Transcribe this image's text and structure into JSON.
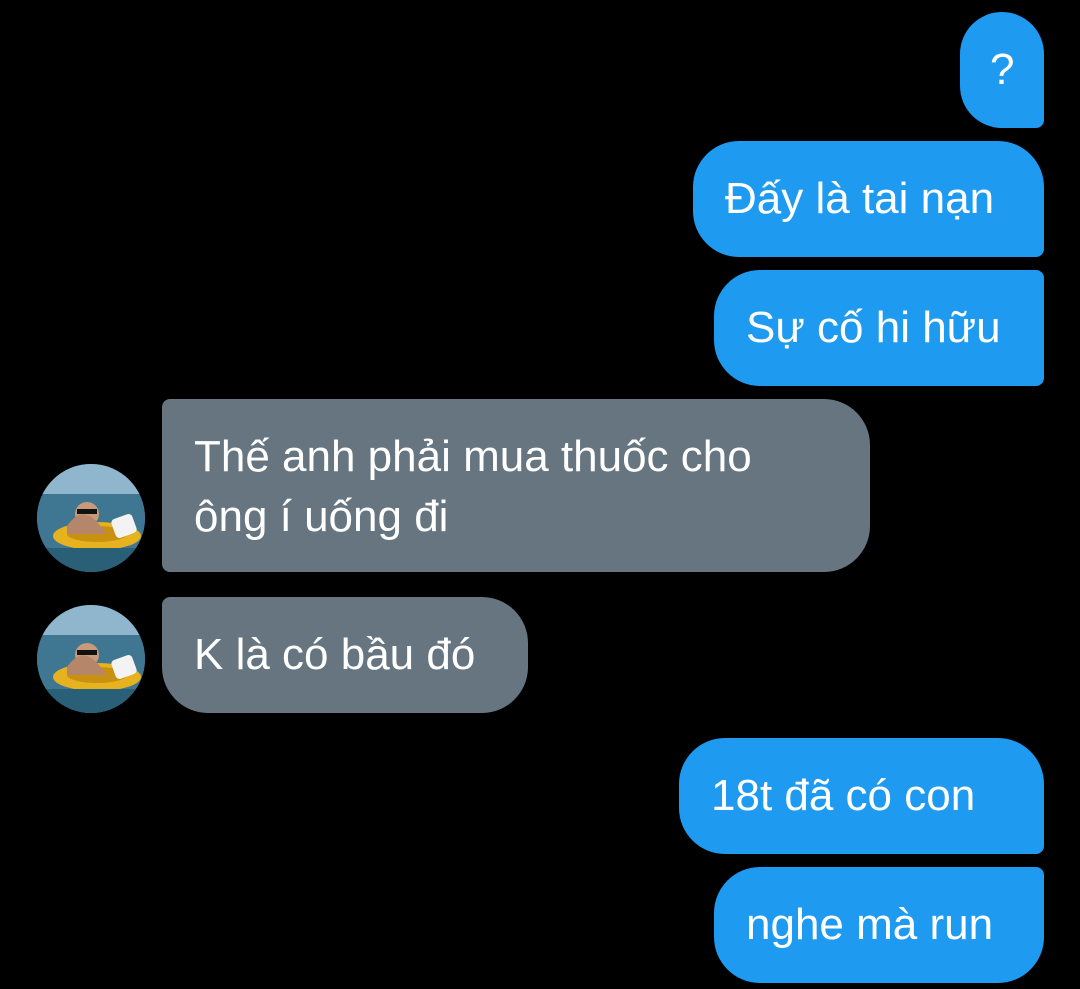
{
  "colors": {
    "background": "#000000",
    "sent_bubble": "#1e9bf0",
    "received_bubble": "#66757f",
    "text": "#ffffff"
  },
  "messages": [
    {
      "sender": "me",
      "text": "?"
    },
    {
      "sender": "me",
      "text": "Đấy là tai nạn"
    },
    {
      "sender": "me",
      "text": "Sự cố hi hữu"
    },
    {
      "sender": "other",
      "text": "Thế anh phải mua thuốc cho ông í uống đi",
      "avatar_icon": "contact-avatar-photo"
    },
    {
      "sender": "other",
      "text": "K là có bầu đó",
      "avatar_icon": "contact-avatar-photo"
    },
    {
      "sender": "me",
      "text": "18t đã có con"
    },
    {
      "sender": "me",
      "text": "nghe mà run"
    }
  ]
}
